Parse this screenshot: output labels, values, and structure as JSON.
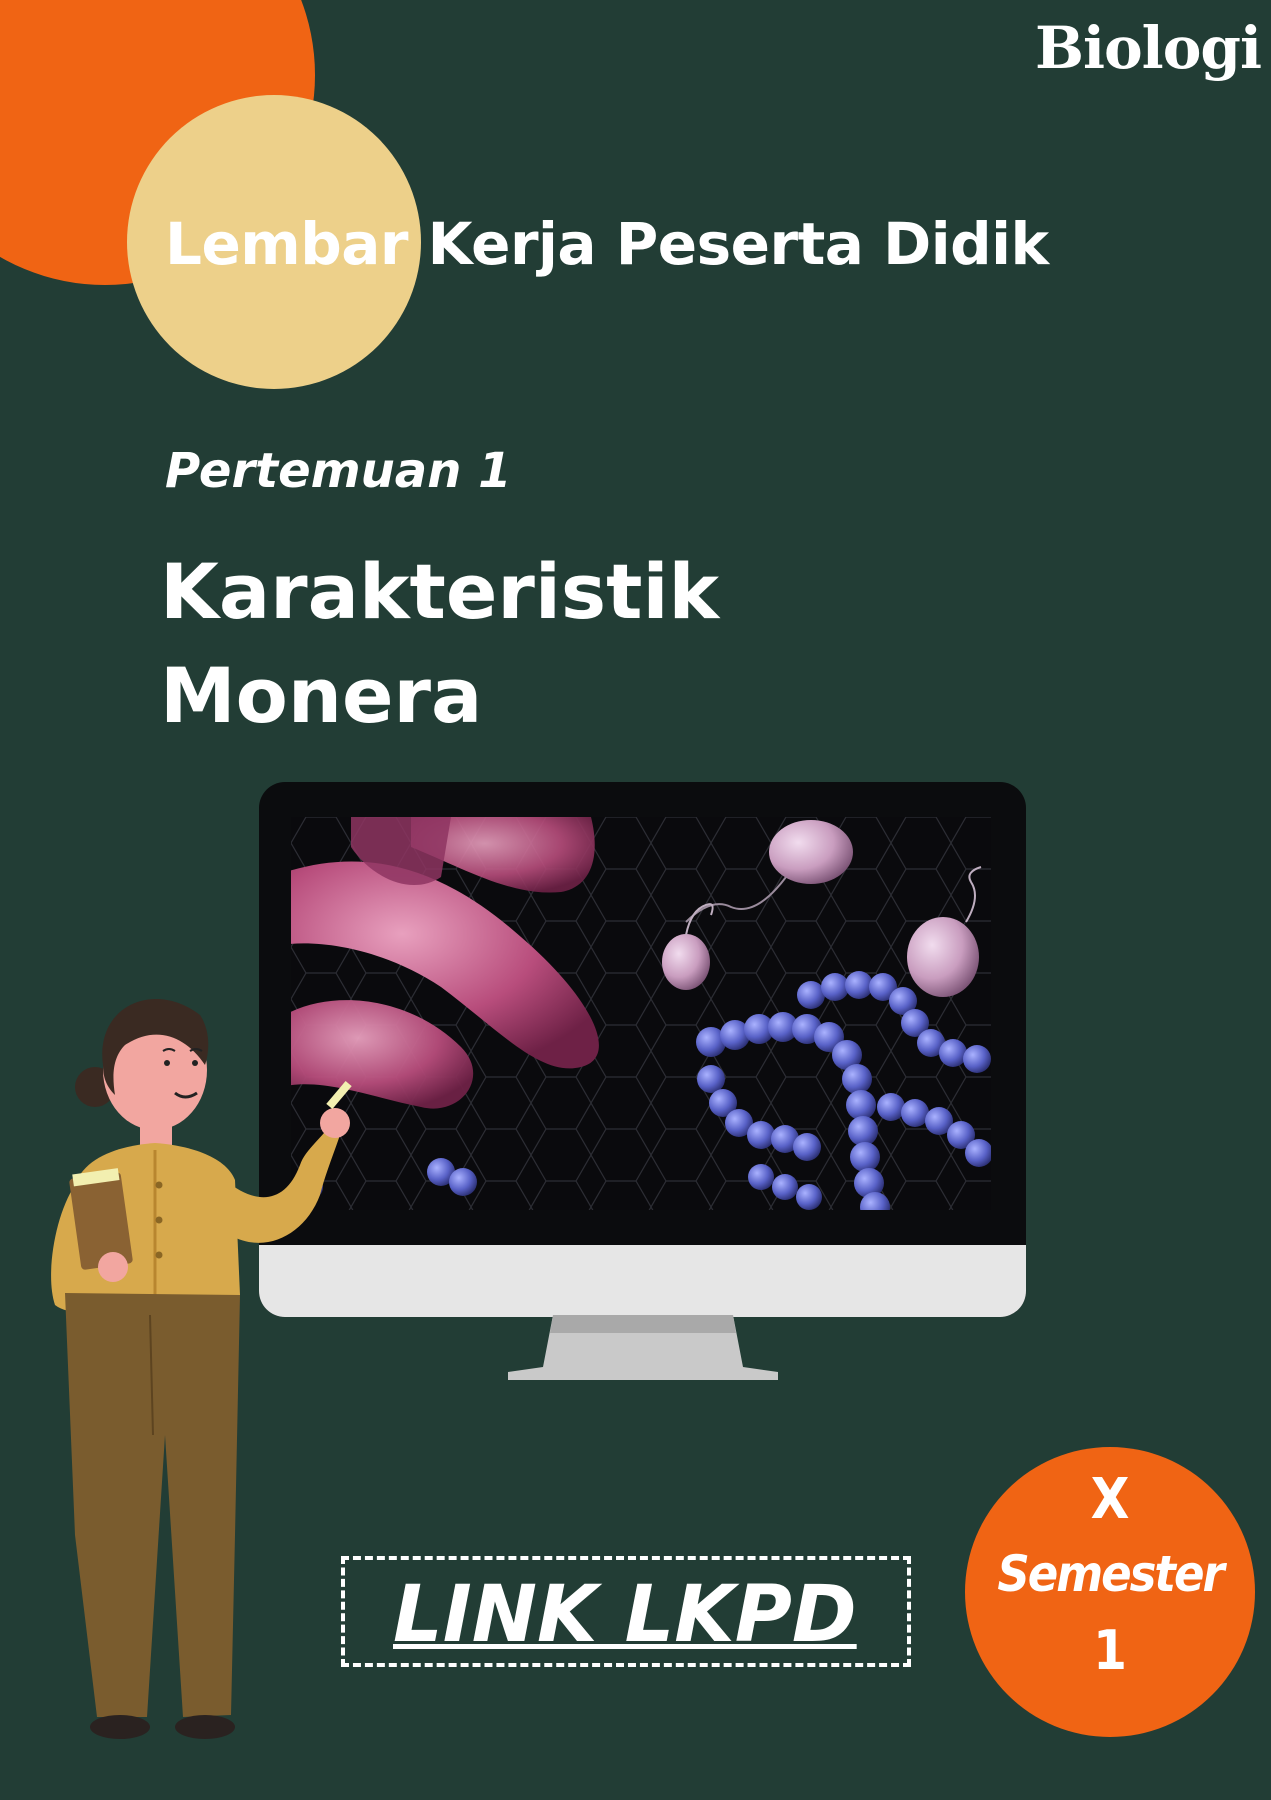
{
  "cover": {
    "subject": "Biologi",
    "title": "Lembar Kerja Peserta Didik",
    "meeting": "Pertemuan 1",
    "topic_line1": "Karakteristik",
    "topic_line2": "Monera",
    "link_label": "LINK LKPD",
    "grade": "X",
    "semester_label": "Semester",
    "semester_number": "1"
  },
  "colors": {
    "background": "#223d35",
    "accent_orange": "#f06414",
    "accent_cream": "#edd08a",
    "text": "#ffffff"
  },
  "icons": {
    "monitor": "desktop-monitor-icon",
    "teacher": "teacher-illustration",
    "bacteria": "bacteria-image"
  }
}
